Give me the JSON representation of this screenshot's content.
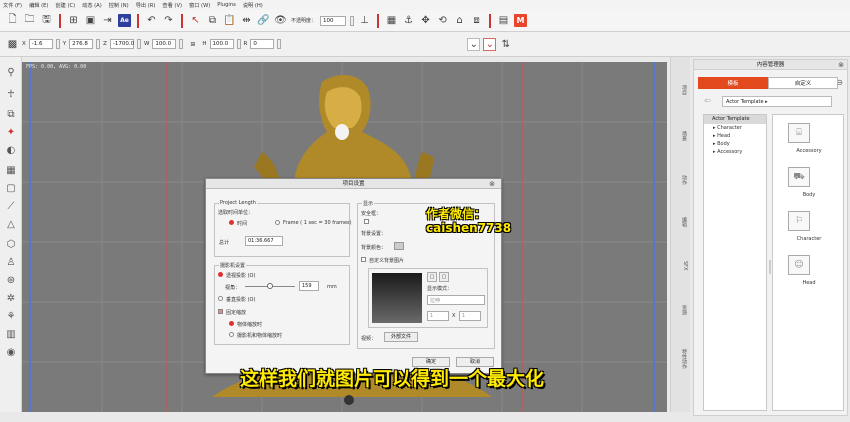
{
  "menu": [
    "文件 (F)",
    "编辑 (E)",
    "创建 (C)",
    "动态 (A)",
    "控制 (N)",
    "导出 (R)",
    "查看 (V)",
    "窗口 (W)",
    "Plugins",
    "说明 (H)"
  ],
  "toolbar": {
    "opacity_label": "不透明度：",
    "opacity_value": "100"
  },
  "transform": {
    "x_label": "X",
    "x_value": "-1.6",
    "y_label": "Y",
    "y_value": "276.8",
    "z_label": "Z",
    "z_value": "-1700.0",
    "w_label": "W",
    "w_value": "100.0",
    "h_label": "H",
    "h_value": "100.0",
    "r_label": "R",
    "r_value": "0"
  },
  "viewport": {
    "fps_text": "FPS: 0.00, AVG: 0.00"
  },
  "dialog": {
    "title": "项目设置",
    "close": "⊗",
    "project_length": {
      "group_title": "Project Length",
      "unit_label": "选取时间单位：",
      "time_option": "时间",
      "frame_option": "Frame ( 1 sec = 30 frames)",
      "total_label": "总计",
      "total_value": "01:36.667"
    },
    "camera": {
      "group_title": "摄影机设置",
      "perspective_option": "透视投影 (O)",
      "fov_label": "视角：",
      "fov_value": "159",
      "fov_unit": "mm",
      "ortho_option": "垂直投影 (O)",
      "fixed_label": "固定缩放",
      "object_option": "物体缩放时",
      "camera_object_option": "摄影机和物体缩放时"
    },
    "display": {
      "group_title": "显示",
      "safe_frame_label": "安全框：",
      "bg_settings_label": "背景设置：",
      "bg_color_label": "背景颜色：",
      "custom_bg_label": "自定义背景图片",
      "display_mode_label": "显示模式：",
      "display_mode_value": "拉伸",
      "tile_x": "1",
      "tile_sep": "X",
      "tile_y": "1",
      "video_label": "视频：",
      "video_button": "外部文件"
    },
    "ok_label": "确定",
    "cancel_label": "取消"
  },
  "overlay": {
    "watermark_line1": "作者微信：",
    "watermark_line2": "caishen7738",
    "subtitle": "这样我们就图片可以得到一个最大化"
  },
  "side_tabs": [
    "项目",
    "场景",
    "动作",
    "编辑",
    "SFX",
    "资源",
    "特性动作"
  ],
  "content_manager": {
    "title": "内容管理器",
    "tabs": [
      "模板",
      "自定义"
    ],
    "path": "Actor Template ▸",
    "tree_root": "Actor Template",
    "tree_items": [
      "Character",
      "Head",
      "Body",
      "Accessory"
    ],
    "thumbs": [
      "Accessory",
      "Body",
      "Character",
      "Head"
    ]
  },
  "colors": {
    "accent": "#e24a1d",
    "subtitle": "#ffea00"
  }
}
